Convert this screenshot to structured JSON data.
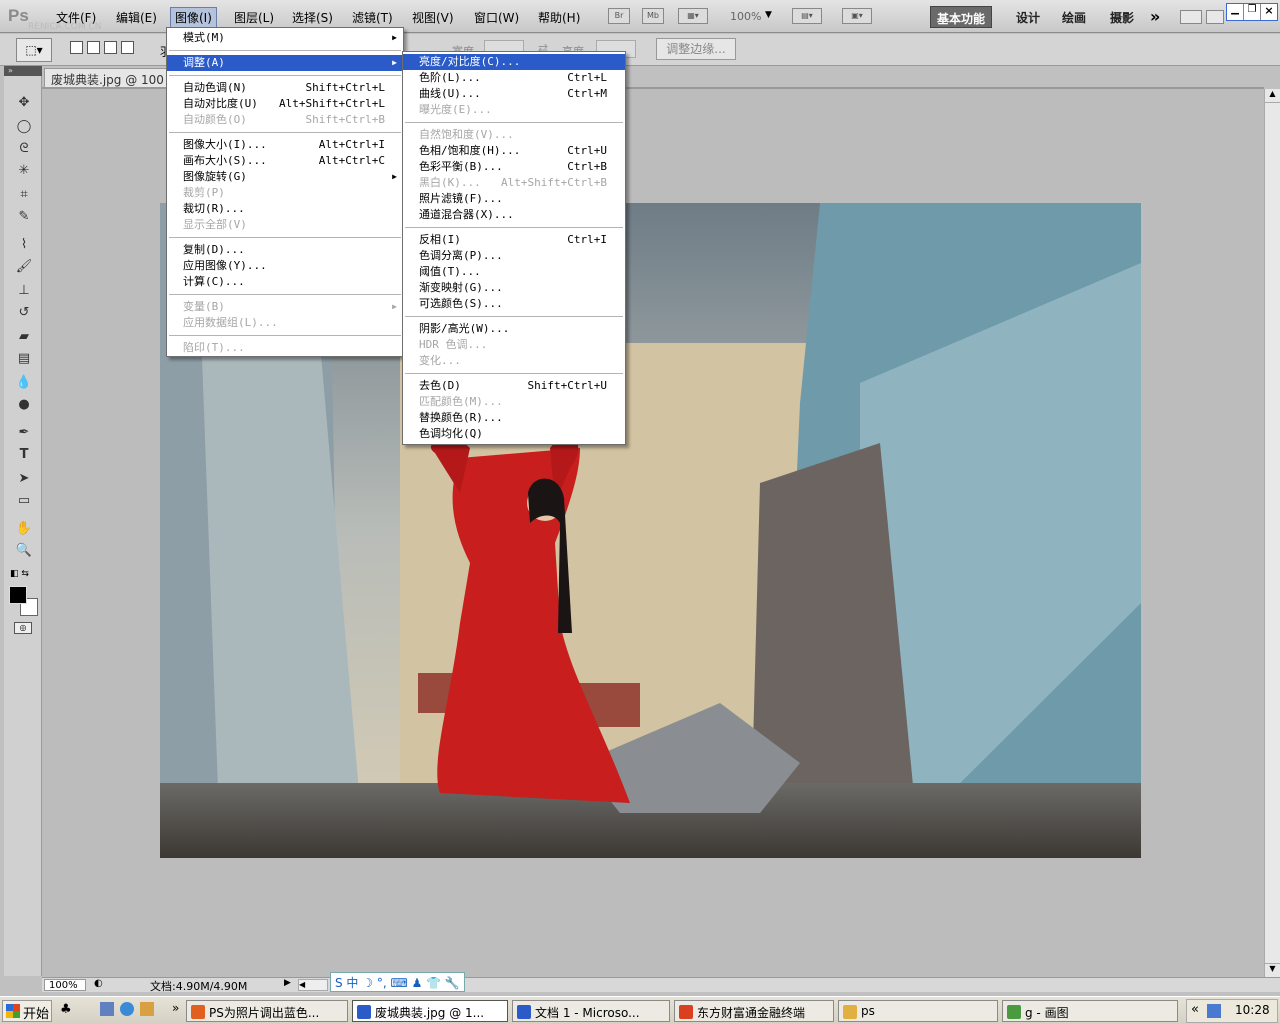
{
  "app": {
    "logo": "Ps",
    "watermark": "RENICA.COM CN"
  },
  "menubar": {
    "items": [
      "文件(F)",
      "编辑(E)",
      "图像(I)",
      "图层(L)",
      "选择(S)",
      "滤镜(T)",
      "视图(V)",
      "窗口(W)",
      "帮助(H)"
    ],
    "active_index": 2,
    "br": "Br",
    "mb": "Mb",
    "zoom": "100%",
    "workspaces": [
      "基本功能",
      "设计",
      "绘画",
      "摄影"
    ],
    "more": "»"
  },
  "optionsbar": {
    "feather_label": "羽",
    "width_label": "宽度",
    "height_label": "高度",
    "refine_edge": "调整边缘..."
  },
  "document": {
    "tab_title": "废城典装.jpg @ 100"
  },
  "status": {
    "zoom": "100%",
    "doc_size": "文档:4.90M/4.90M",
    "ime": "S 中 ☽ °, ⌨ ♟ 👕 🔧"
  },
  "image_menu": [
    {
      "label": "模式(M)",
      "shortcut": "",
      "submenu": true,
      "disabled": false
    },
    {
      "sep": true
    },
    {
      "label": "调整(A)",
      "shortcut": "",
      "submenu": true,
      "disabled": false,
      "highlight": true
    },
    {
      "sep": true
    },
    {
      "label": "自动色调(N)",
      "shortcut": "Shift+Ctrl+L",
      "disabled": false
    },
    {
      "label": "自动对比度(U)",
      "shortcut": "Alt+Shift+Ctrl+L",
      "disabled": false
    },
    {
      "label": "自动颜色(O)",
      "shortcut": "Shift+Ctrl+B",
      "disabled": true
    },
    {
      "sep": true
    },
    {
      "label": "图像大小(I)...",
      "shortcut": "Alt+Ctrl+I",
      "disabled": false
    },
    {
      "label": "画布大小(S)...",
      "shortcut": "Alt+Ctrl+C",
      "disabled": false
    },
    {
      "label": "图像旋转(G)",
      "shortcut": "",
      "submenu": true,
      "disabled": false
    },
    {
      "label": "裁剪(P)",
      "shortcut": "",
      "disabled": true
    },
    {
      "label": "裁切(R)...",
      "shortcut": "",
      "disabled": false
    },
    {
      "label": "显示全部(V)",
      "shortcut": "",
      "disabled": true
    },
    {
      "sep": true
    },
    {
      "label": "复制(D)...",
      "shortcut": "",
      "disabled": false
    },
    {
      "label": "应用图像(Y)...",
      "shortcut": "",
      "disabled": false
    },
    {
      "label": "计算(C)...",
      "shortcut": "",
      "disabled": false
    },
    {
      "sep": true
    },
    {
      "label": "变量(B)",
      "shortcut": "",
      "submenu": true,
      "disabled": true
    },
    {
      "label": "应用数据组(L)...",
      "shortcut": "",
      "disabled": true
    },
    {
      "sep": true
    },
    {
      "label": "陷印(T)...",
      "shortcut": "",
      "disabled": true
    }
  ],
  "adjust_menu": [
    {
      "label": "亮度/对比度(C)...",
      "shortcut": "",
      "disabled": false,
      "highlight": true
    },
    {
      "label": "色阶(L)...",
      "shortcut": "Ctrl+L",
      "disabled": false
    },
    {
      "label": "曲线(U)...",
      "shortcut": "Ctrl+M",
      "disabled": false
    },
    {
      "label": "曝光度(E)...",
      "shortcut": "",
      "disabled": true
    },
    {
      "sep": true
    },
    {
      "label": "自然饱和度(V)...",
      "shortcut": "",
      "disabled": true
    },
    {
      "label": "色相/饱和度(H)...",
      "shortcut": "Ctrl+U",
      "disabled": false
    },
    {
      "label": "色彩平衡(B)...",
      "shortcut": "Ctrl+B",
      "disabled": false
    },
    {
      "label": "黑白(K)...",
      "shortcut": "Alt+Shift+Ctrl+B",
      "disabled": true
    },
    {
      "label": "照片滤镜(F)...",
      "shortcut": "",
      "disabled": false
    },
    {
      "label": "通道混合器(X)...",
      "shortcut": "",
      "disabled": false
    },
    {
      "sep": true
    },
    {
      "label": "反相(I)",
      "shortcut": "Ctrl+I",
      "disabled": false
    },
    {
      "label": "色调分离(P)...",
      "shortcut": "",
      "disabled": false
    },
    {
      "label": "阈值(T)...",
      "shortcut": "",
      "disabled": false
    },
    {
      "label": "渐变映射(G)...",
      "shortcut": "",
      "disabled": false
    },
    {
      "label": "可选颜色(S)...",
      "shortcut": "",
      "disabled": false
    },
    {
      "sep": true
    },
    {
      "label": "阴影/高光(W)...",
      "shortcut": "",
      "disabled": false
    },
    {
      "label": "HDR 色调...",
      "shortcut": "",
      "disabled": true
    },
    {
      "label": "变化...",
      "shortcut": "",
      "disabled": true
    },
    {
      "sep": true
    },
    {
      "label": "去色(D)",
      "shortcut": "Shift+Ctrl+U",
      "disabled": false
    },
    {
      "label": "匹配颜色(M)...",
      "shortcut": "",
      "disabled": true
    },
    {
      "label": "替换颜色(R)...",
      "shortcut": "",
      "disabled": false
    },
    {
      "label": "色调均化(Q)",
      "shortcut": "",
      "disabled": false
    }
  ],
  "taskbar": {
    "start": "开始",
    "tasks": [
      "PS为照片调出蓝色...",
      "废城典装.jpg @ 1...",
      "文档 1 - Microso...",
      "东方财富通金融终端",
      "ps",
      "g - 画图"
    ],
    "active_index": 1,
    "clock": "10:28"
  },
  "colors": {
    "menu_highlight": "#2a5bc8",
    "dress_red": "#c81e1e"
  }
}
